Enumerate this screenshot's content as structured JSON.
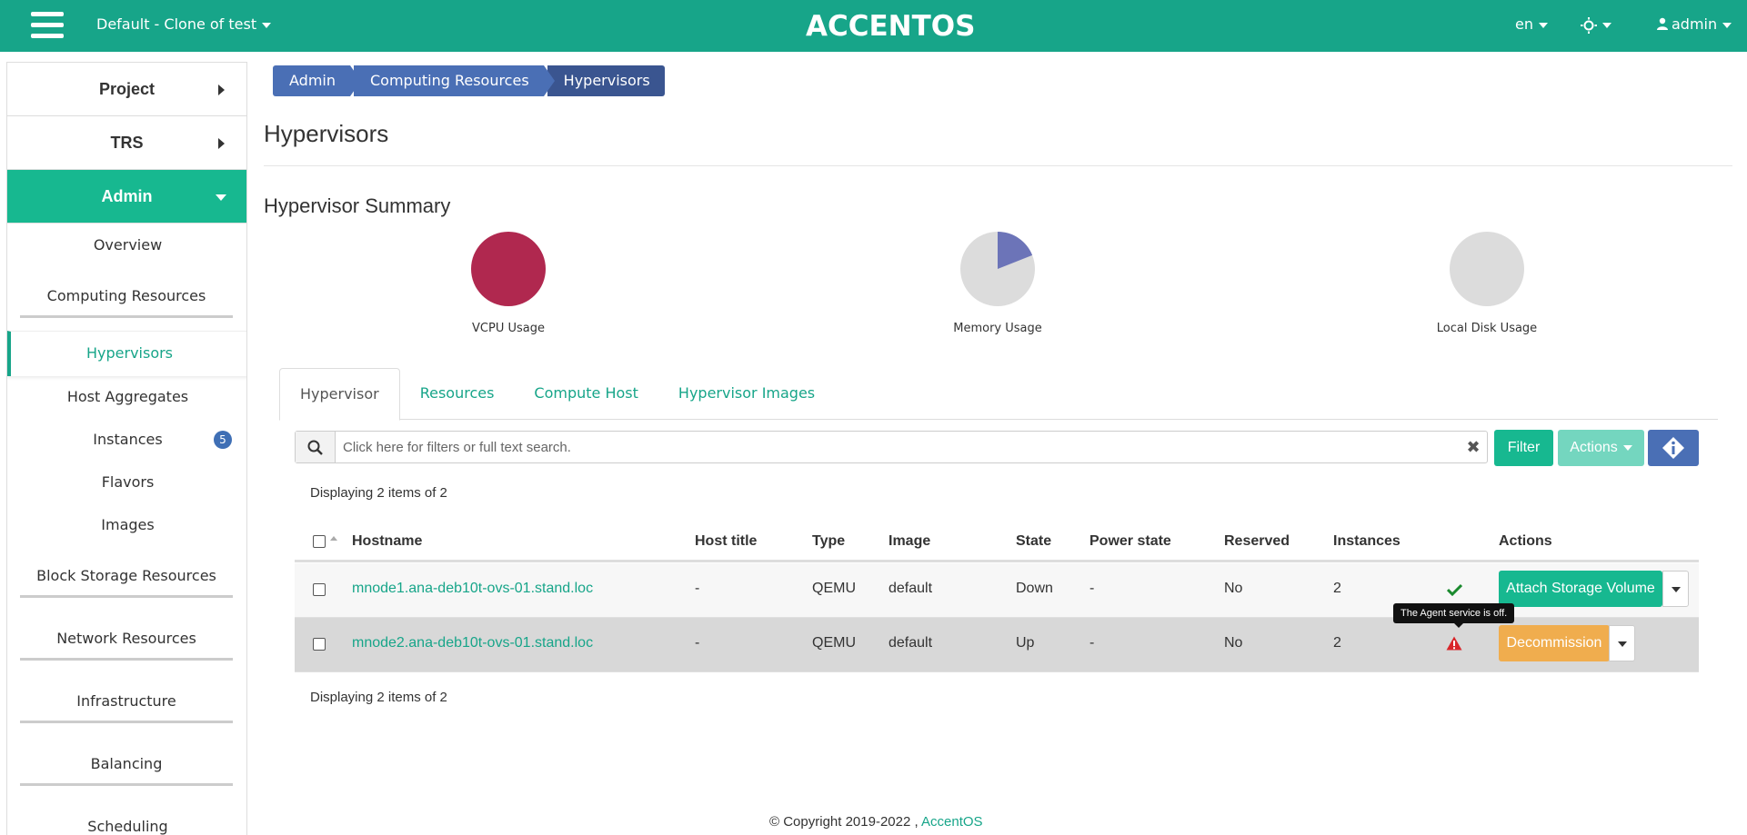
{
  "topbar": {
    "project": "Default - Clone of test",
    "logo": "ACCENTOS",
    "lang": "en",
    "user": "admin",
    "bg_color": "#17a589"
  },
  "sidebar": {
    "sections": [
      {
        "label": "Project"
      },
      {
        "label": "TRS"
      },
      {
        "label": "Admin"
      }
    ],
    "items": [
      {
        "label": "Overview"
      },
      {
        "label": "Computing Resources"
      },
      {
        "label": "Hypervisors"
      },
      {
        "label": "Host Aggregates"
      },
      {
        "label": "Instances",
        "badge": "5"
      },
      {
        "label": "Flavors"
      },
      {
        "label": "Images"
      },
      {
        "label": "Block Storage Resources"
      },
      {
        "label": "Network Resources"
      },
      {
        "label": "Infrastructure"
      },
      {
        "label": "Balancing"
      },
      {
        "label": "Scheduling"
      }
    ]
  },
  "breadcrumb": [
    "Admin",
    "Computing Resources",
    "Hypervisors"
  ],
  "page_title": "Hypervisors",
  "summary": {
    "title": "Hypervisor Summary",
    "pies": [
      {
        "label": "VCPU Usage",
        "used_fraction": 1.0,
        "color": "#b0284f"
      },
      {
        "label": "Memory Usage",
        "used_fraction": 0.19,
        "color": "#6c74b8"
      },
      {
        "label": "Local Disk Usage",
        "used_fraction": 0.0,
        "color": "#6c74b8"
      }
    ]
  },
  "tabs": [
    "Hypervisor",
    "Resources",
    "Compute Host",
    "Hypervisor Images"
  ],
  "search": {
    "placeholder": "Click here for filters or full text search."
  },
  "buttons": {
    "filter": "Filter",
    "actions": "Actions"
  },
  "display_count": "Displaying 2 items of 2",
  "table": {
    "headers": [
      "Hostname",
      "Host title",
      "Type",
      "Image",
      "State",
      "Power state",
      "Reserved",
      "Instances",
      "Actions"
    ],
    "rows": [
      {
        "hostname": "mnode1.ana-deb10t-ovs-01.stand.loc",
        "host_title": "-",
        "type": "QEMU",
        "image": "default",
        "state": "Down",
        "power_state": "-",
        "reserved": "No",
        "instances": "2",
        "status_icon": "check-icon",
        "action": "Attach Storage Volume",
        "action_color": "#17b890"
      },
      {
        "hostname": "mnode2.ana-deb10t-ovs-01.stand.loc",
        "host_title": "-",
        "type": "QEMU",
        "image": "default",
        "state": "Up",
        "power_state": "-",
        "reserved": "No",
        "instances": "2",
        "status_icon": "warning-icon",
        "action": "Decommission",
        "action_color": "#f0ad4e"
      }
    ]
  },
  "tooltip": "The Agent service is off.",
  "footer": {
    "copyright": "© Copyright 2019-2022 ,",
    "link": "AccentOS"
  }
}
